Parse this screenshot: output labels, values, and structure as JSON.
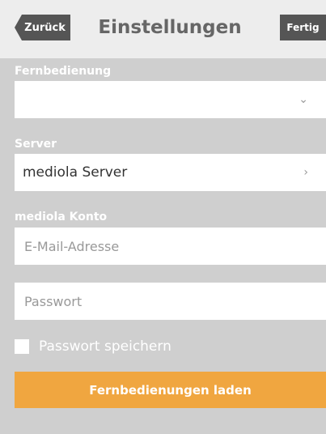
{
  "header": {
    "back_label": "Zurück",
    "title": "Einstellungen",
    "done_label": "Fertig"
  },
  "remote": {
    "label": "Fernbedienung",
    "value": "",
    "chevron_icon": "chevron-down-icon"
  },
  "server": {
    "label": "Server",
    "value": "mediola Server",
    "chevron_icon": "chevron-right-icon"
  },
  "account": {
    "label": "mediola Konto",
    "email_placeholder": "E-Mail-Adresse",
    "password_placeholder": "Passwort"
  },
  "save_password": {
    "label": "Passwort speichern",
    "checked": false
  },
  "load_button": {
    "label": "Fernbedienungen laden"
  },
  "colors": {
    "accent": "#f0a640",
    "background": "#cfcfcf",
    "nav_button": "#555555"
  }
}
